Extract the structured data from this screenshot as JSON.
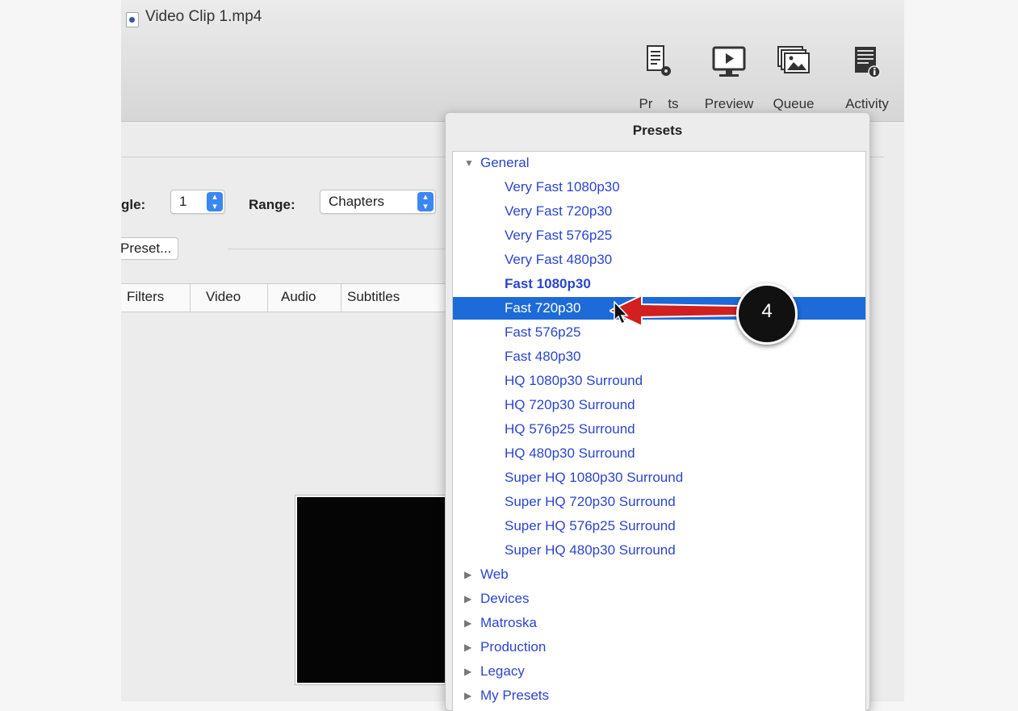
{
  "window": {
    "title": "Video Clip 1.mp4"
  },
  "toolbar": {
    "items": [
      {
        "label": "Presets",
        "icon": "presets-icon"
      },
      {
        "label": "Preview",
        "icon": "preview-icon"
      },
      {
        "label": "Queue",
        "icon": "queue-icon"
      },
      {
        "label": "Activity",
        "icon": "activity-icon"
      }
    ],
    "presets_visible_label": "Pr    ts"
  },
  "source": {
    "angle_label": "gle:",
    "angle_value": "1",
    "range_label": "Range:",
    "range_value": "Chapters",
    "preset_button_label": "Preset..."
  },
  "tabs": [
    "Filters",
    "Video",
    "Audio",
    "Subtitles"
  ],
  "presets_popover": {
    "title": "Presets",
    "groups": [
      {
        "name": "General",
        "expanded": true,
        "items": [
          "Very Fast 1080p30",
          "Very Fast 720p30",
          "Very Fast 576p25",
          "Very Fast 480p30",
          "Fast 1080p30",
          "Fast 720p30",
          "Fast 576p25",
          "Fast 480p30",
          "HQ 1080p30 Surround",
          "HQ 720p30 Surround",
          "HQ 576p25 Surround",
          "HQ 480p30 Surround",
          "Super HQ 1080p30 Surround",
          "Super HQ 720p30 Surround",
          "Super HQ 576p25 Surround",
          "Super HQ 480p30 Surround"
        ],
        "bold_item": "Fast 1080p30",
        "selected_item": "Fast 720p30"
      },
      {
        "name": "Web",
        "expanded": false
      },
      {
        "name": "Devices",
        "expanded": false
      },
      {
        "name": "Matroska",
        "expanded": false
      },
      {
        "name": "Production",
        "expanded": false
      },
      {
        "name": "Legacy",
        "expanded": false
      },
      {
        "name": "My Presets",
        "expanded": false
      }
    ]
  },
  "callout": {
    "number": "4",
    "color": "#d21f1f"
  },
  "colors": {
    "link_blue": "#2a45cf",
    "selection_blue": "#1d6ad9",
    "accent_blue": "#3b87f0"
  }
}
